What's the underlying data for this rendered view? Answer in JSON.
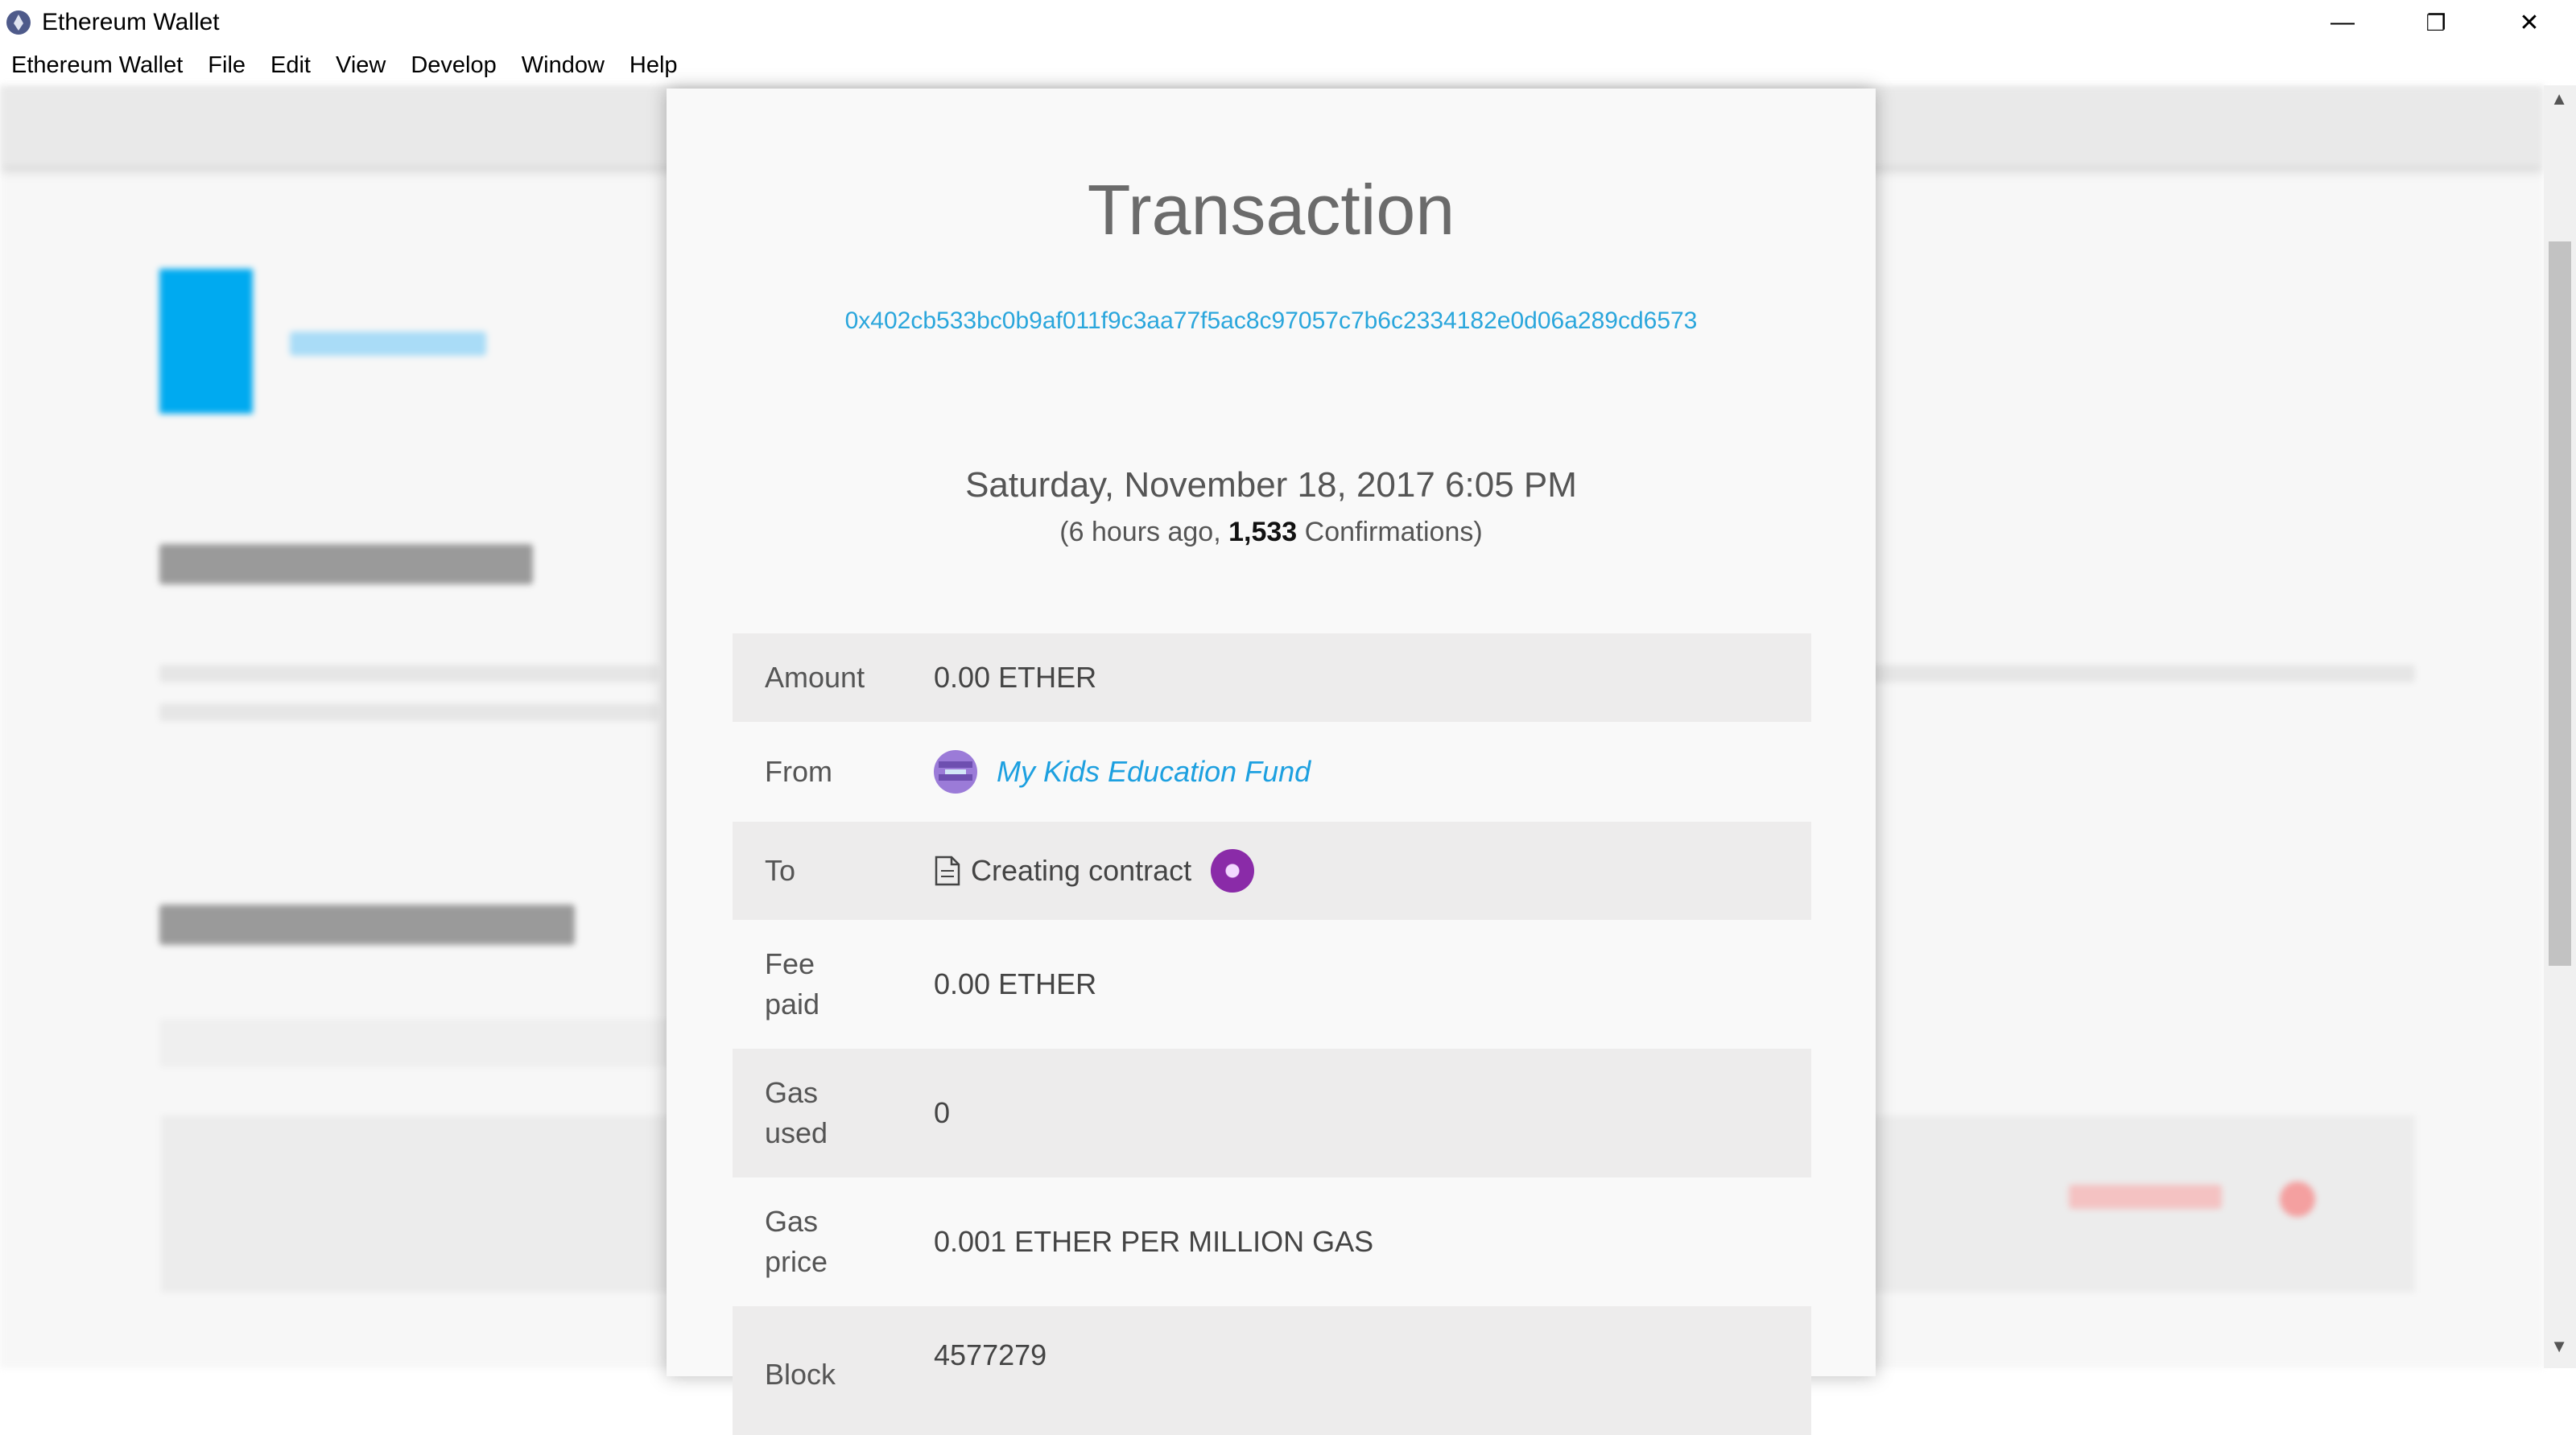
{
  "window": {
    "title": "Ethereum Wallet",
    "controls": {
      "minimize": "—",
      "restore": "❐",
      "close": "✕"
    }
  },
  "menu": [
    "Ethereum Wallet",
    "File",
    "Edit",
    "View",
    "Develop",
    "Window",
    "Help"
  ],
  "transaction": {
    "heading": "Transaction",
    "hash": "0x402cb533bc0b9af011f9c3aa77f5ac8c97057c7b6c2334182e0d06a289cd6573",
    "date": "Saturday, November 18, 2017 6:05 PM",
    "ago_prefix": "(6 hours ago, ",
    "confirmations": "1,533",
    "ago_suffix": " Confirmations)",
    "details": {
      "amount": {
        "label": "Amount",
        "value": "0.00 ETHER"
      },
      "from": {
        "label": "From",
        "value": "My Kids Education Fund",
        "icon": "identicon"
      },
      "to": {
        "label": "To",
        "value": "Creating contract",
        "icon": "document-icon"
      },
      "fee": {
        "label": "Fee paid",
        "value": "0.00 ETHER"
      },
      "gas_used": {
        "label": "Gas used",
        "value": "0"
      },
      "gas_price": {
        "label": "Gas price",
        "value": "0.001 ETHER PER MILLION GAS"
      },
      "block": {
        "label": "Block",
        "value": "4577279"
      }
    }
  },
  "colors": {
    "link": "#2aa6dc",
    "accent": "#00aaf0",
    "row_shade": "#edecec"
  }
}
